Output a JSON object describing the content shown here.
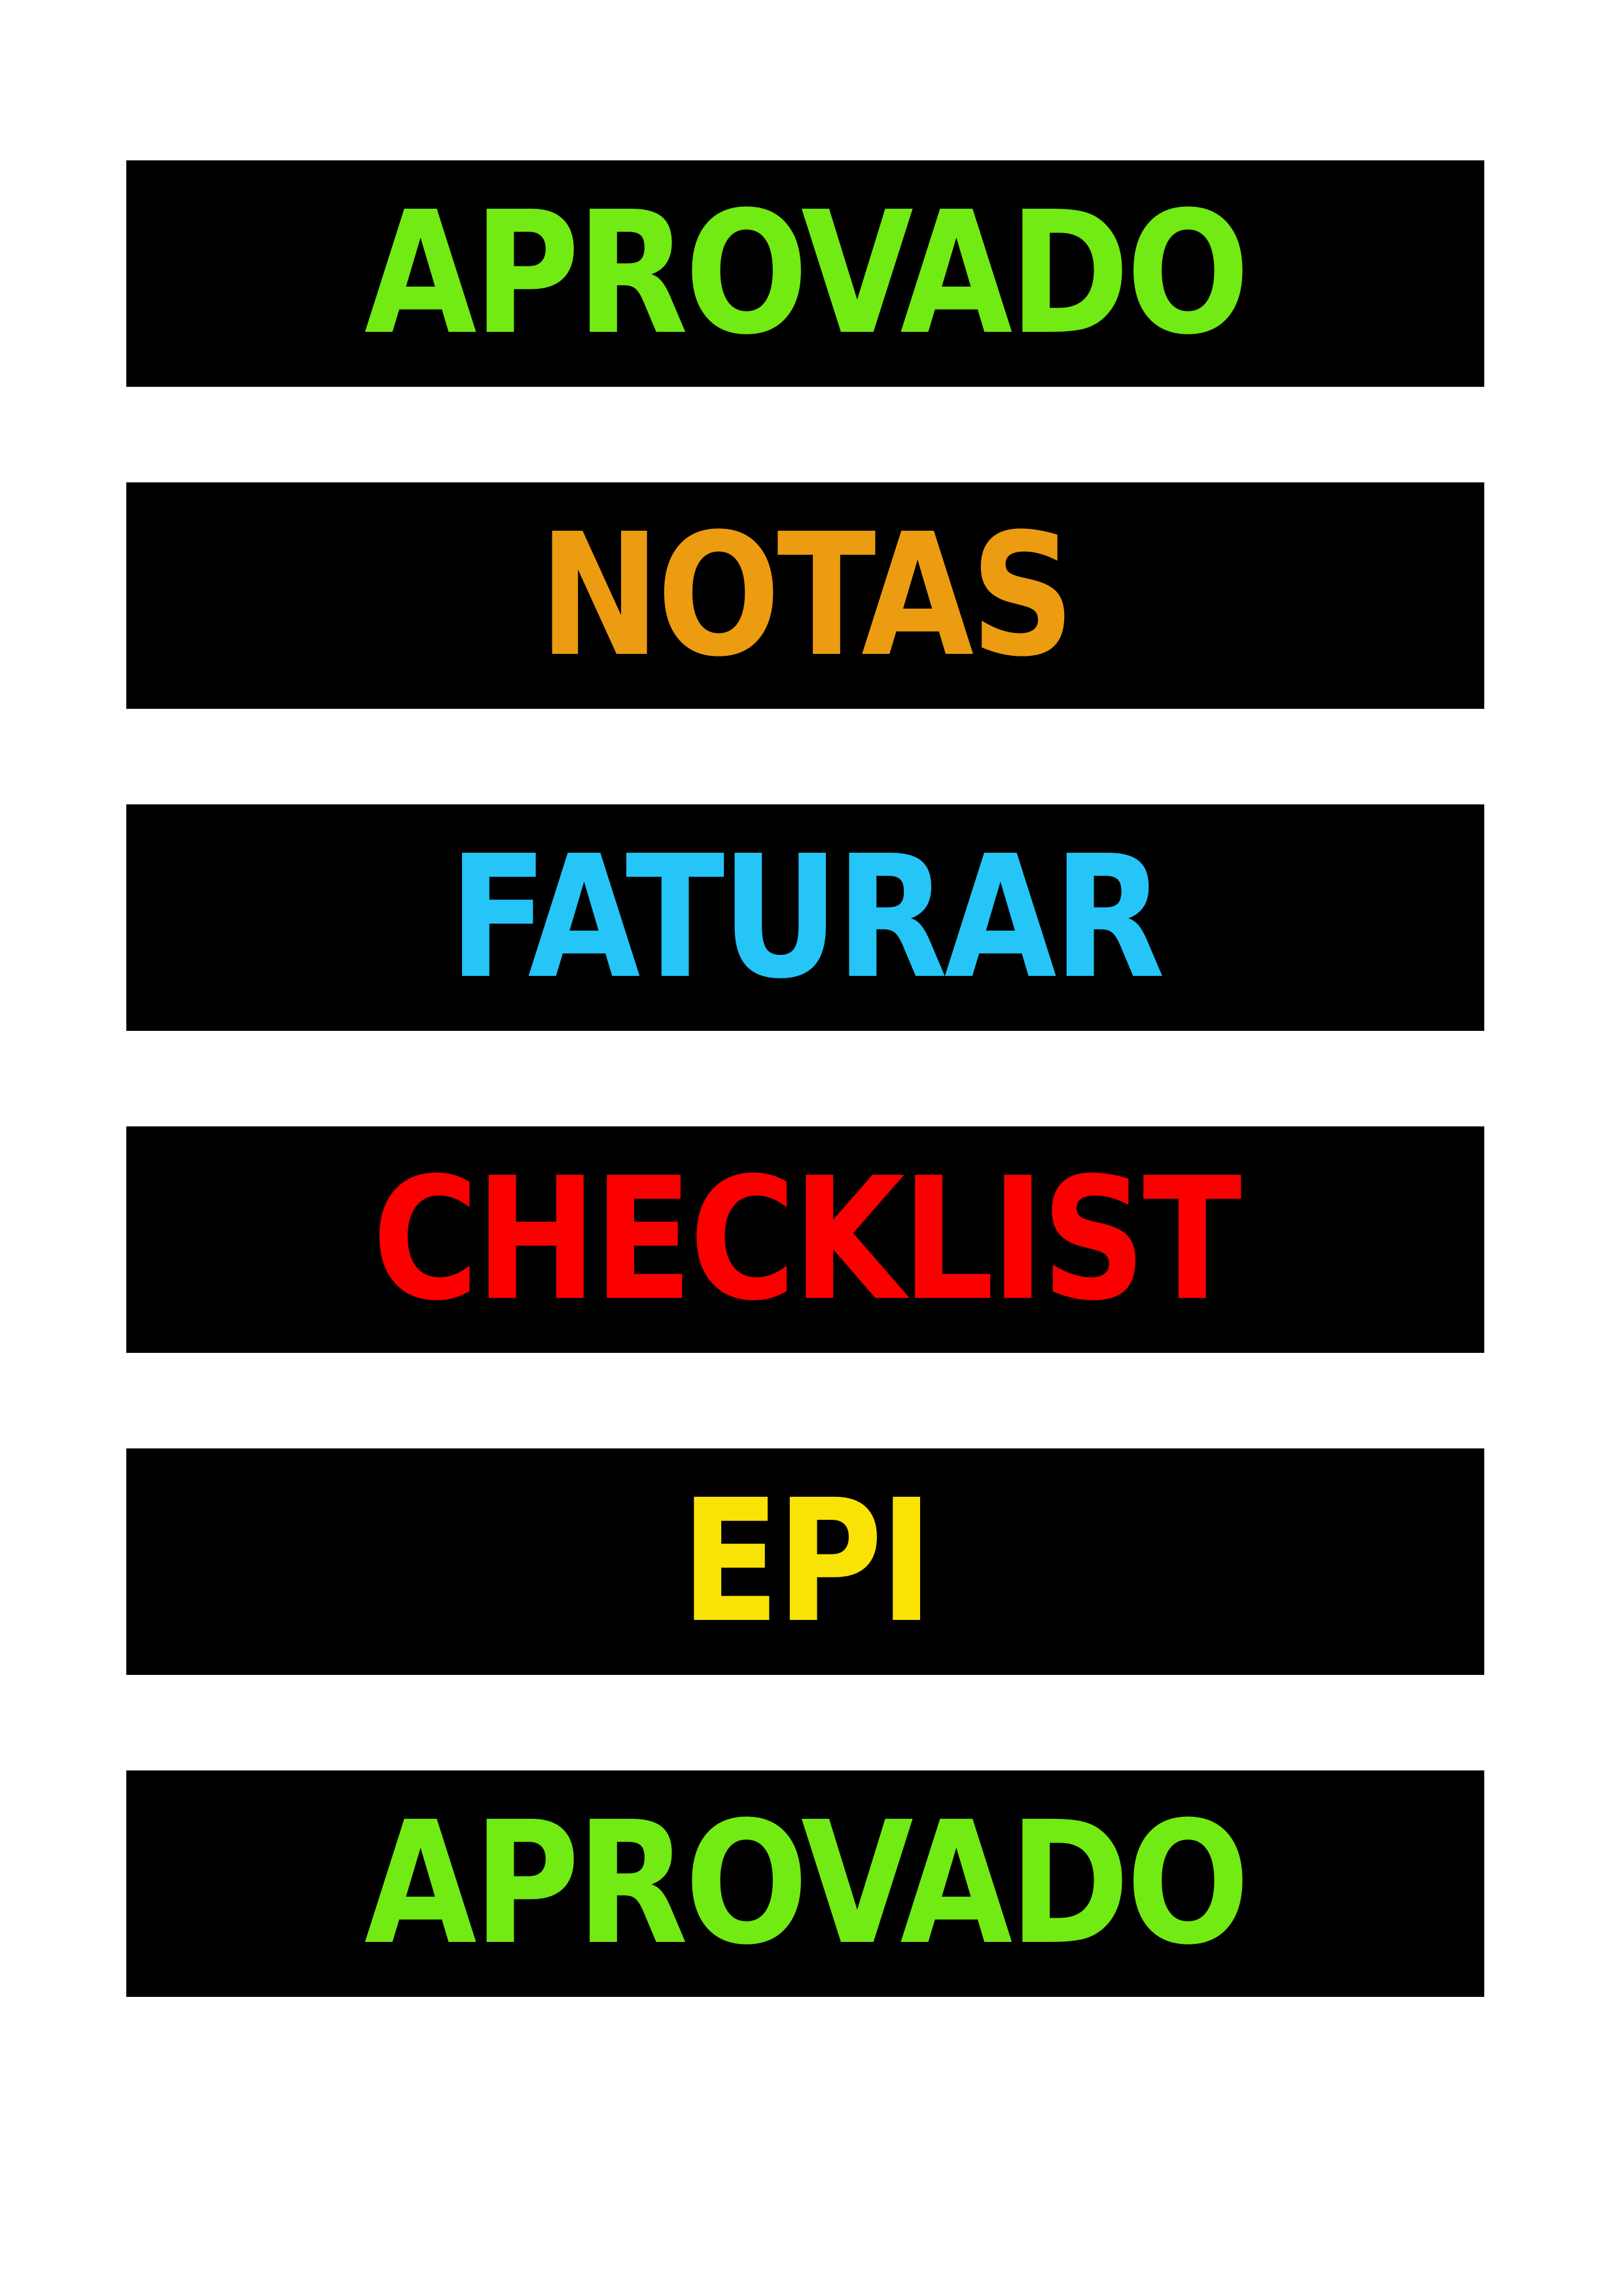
{
  "labels": [
    {
      "text": "APROVADO",
      "color": "#72EA13"
    },
    {
      "text": "NOTAS",
      "color": "#EC9C10"
    },
    {
      "text": "FATURAR",
      "color": "#26C5F8"
    },
    {
      "text": "CHECKLIST",
      "color": "#FB0000"
    },
    {
      "text": "EPI",
      "color": "#F9E307"
    },
    {
      "text": "APROVADO",
      "color": "#72EA13"
    }
  ]
}
